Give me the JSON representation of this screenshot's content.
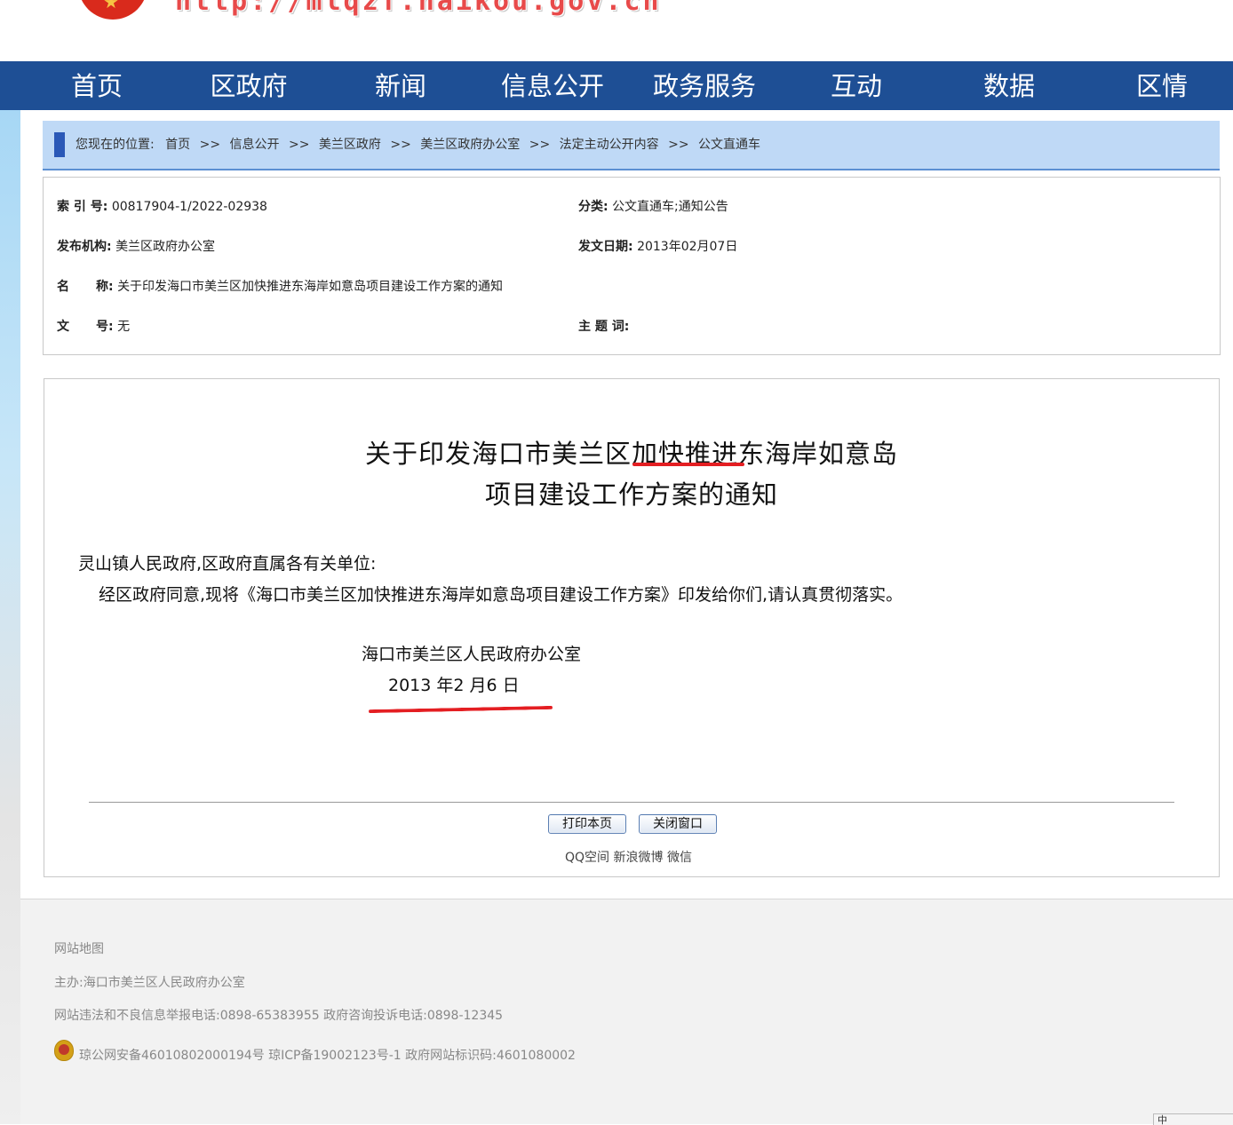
{
  "header": {
    "site_url": "http://mlqzf.haikou.gov.cn"
  },
  "nav": {
    "items": [
      "首页",
      "区政府",
      "新闻",
      "信息公开",
      "政务服务",
      "互动",
      "数据",
      "区情"
    ]
  },
  "breadcrumb": {
    "prefix": "您现在的位置:",
    "items": [
      "首页",
      "信息公开",
      "美兰区政府",
      "美兰区政府办公室",
      "法定主动公开内容",
      "公文直通车"
    ],
    "separator": ">>"
  },
  "meta": {
    "index_label": "索 引 号:",
    "index_value": "00817904-1/2022-02938",
    "category_label": "分类:",
    "category_value": "公文直通车;通知公告",
    "publisher_label": "发布机构:",
    "publisher_value": "美兰区政府办公室",
    "date_label": "发文日期:",
    "date_value": "2013年02月07日",
    "name_label_1": "名",
    "name_label_2": "称:",
    "name_value": "关于印发海口市美兰区加快推进东海岸如意岛项目建设工作方案的通知",
    "docno_label_1": "文",
    "docno_label_2": "号:",
    "docno_value": "无",
    "keyword_label": "主 题 词:"
  },
  "document": {
    "title_line1": "关于印发海口市美兰区加快推进东海岸如意岛",
    "title_line2": "项目建设工作方案的通知",
    "addressee": "灵山镇人民政府,区政府直属各有关单位:",
    "body": "经区政府同意,现将《海口市美兰区加快推进东海岸如意岛项目建设工作方案》印发给你们,请认真贯彻落实。",
    "signer": "海口市美兰区人民政府办公室",
    "sign_date": "2013 年2 月6 日"
  },
  "actions": {
    "print_label": "打印本页",
    "close_label": "关闭窗口",
    "share_qzone": "QQ空间",
    "share_weibo": "新浪微博",
    "share_wechat": "微信"
  },
  "footer": {
    "sitemap": "网站地图",
    "host": "主办:海口市美兰区人民政府办公室",
    "report": "网站违法和不良信息举报电话:0898-65383955 政府咨询投诉电话:0898-12345",
    "record": "琼公网安备46010802000194号 琼ICP备19002123号-1 政府网站标识码:4601080002"
  },
  "ime": {
    "label": "中"
  },
  "colors": {
    "nav_bg": "#1e4f95",
    "breadcrumb_bg": "#bfd9f6",
    "annotation_red": "#e41e22"
  }
}
